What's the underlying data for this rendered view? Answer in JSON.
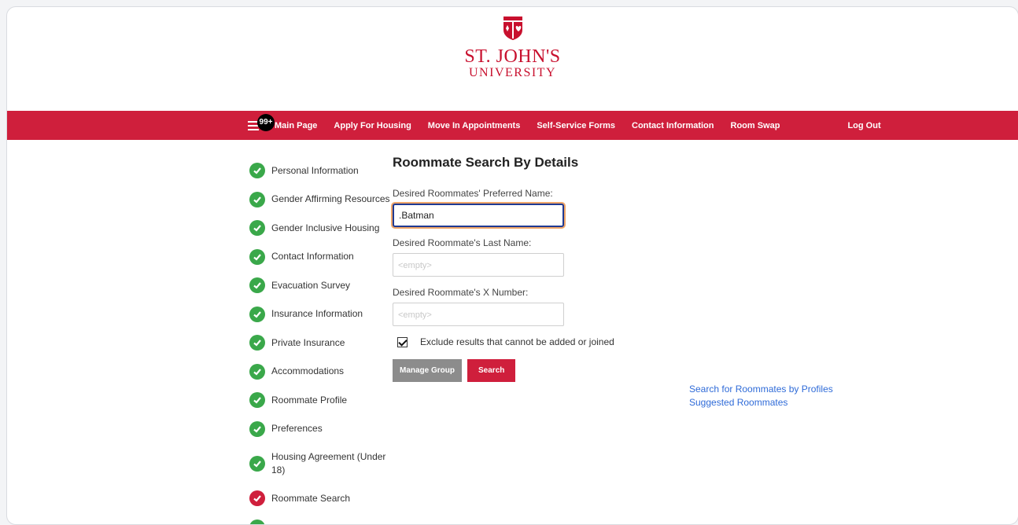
{
  "logo": {
    "line1": "ST. JOHN'S",
    "line2": "UNIVERSITY",
    "brand_color": "#c8102e"
  },
  "nav": {
    "badge": "99+",
    "items": [
      {
        "label": "Main Page"
      },
      {
        "label": "Apply For Housing"
      },
      {
        "label": "Move In Appointments"
      },
      {
        "label": "Self-Service Forms"
      },
      {
        "label": "Contact Information"
      },
      {
        "label": "Room Swap"
      },
      {
        "label": "Log Out"
      }
    ],
    "bar_color": "#cf1f3c"
  },
  "steps": [
    {
      "label": "Personal Information",
      "status": "complete"
    },
    {
      "label": "Gender Affirming Resources",
      "status": "complete"
    },
    {
      "label": "Gender Inclusive Housing",
      "status": "complete"
    },
    {
      "label": "Contact Information",
      "status": "complete"
    },
    {
      "label": "Evacuation Survey",
      "status": "complete"
    },
    {
      "label": "Insurance Information",
      "status": "complete"
    },
    {
      "label": "Private Insurance",
      "status": "complete"
    },
    {
      "label": "Accommodations",
      "status": "complete"
    },
    {
      "label": "Roommate Profile",
      "status": "complete"
    },
    {
      "label": "Preferences",
      "status": "complete"
    },
    {
      "label": "Housing Agreement (Under 18)",
      "status": "complete"
    },
    {
      "label": "Roommate Search",
      "status": "current"
    }
  ],
  "main": {
    "title": "Roommate Search By Details",
    "preferred_name": {
      "label": "Desired Roommates' Preferred Name:",
      "value": ".Batman"
    },
    "last_name": {
      "label": "Desired Roommate's Last Name:",
      "placeholder": "<empty>"
    },
    "x_number": {
      "label": "Desired Roommate's X Number:",
      "placeholder": "<empty>"
    },
    "exclude_checkbox": {
      "label": "Exclude results that cannot be added or joined",
      "checked": true
    },
    "manage_group_label": "Manage Group",
    "search_label": "Search"
  },
  "links": {
    "profiles": "Search for Roommates by Profiles",
    "suggested": "Suggested Roommates"
  },
  "colors": {
    "complete": "#3aa84a",
    "current": "#cf1f3c",
    "link": "#2f6bd8"
  }
}
